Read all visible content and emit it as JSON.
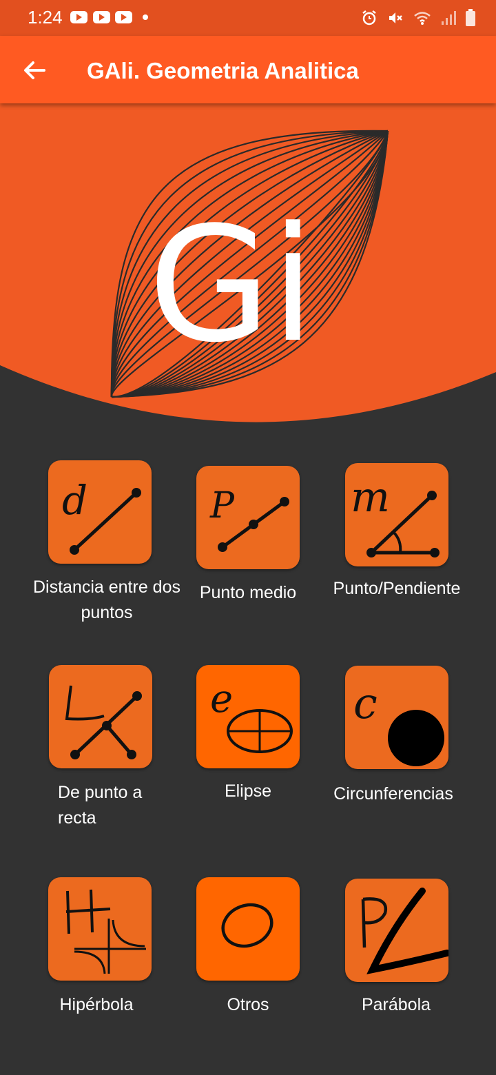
{
  "status_bar": {
    "time": "1:24",
    "icons": [
      "youtube-icon",
      "youtube-icon",
      "youtube-icon",
      "notification-dot",
      "alarm-icon",
      "mute-icon",
      "wifi-icon",
      "signal-icon",
      "battery-icon"
    ]
  },
  "app_bar": {
    "back_icon": "arrow-left-icon",
    "title": "GAli. Geometria Analitica"
  },
  "logo": {
    "text": "Gi"
  },
  "colors": {
    "status_bar": "#E2501F",
    "app_bar": "#FF5A22",
    "hero": "#F05A24",
    "background": "#323232",
    "tile": "#EC6A1F",
    "tile_bright": "#FF6600"
  },
  "menu": {
    "items": [
      {
        "label": "Distancia entre dos puntos",
        "icon": "distance-icon"
      },
      {
        "label": "Punto medio",
        "icon": "midpoint-icon"
      },
      {
        "label": "Punto/Pendiente",
        "icon": "slope-icon"
      },
      {
        "label": "De punto a recta",
        "icon": "point-line-icon"
      },
      {
        "label": "Elipse",
        "icon": "ellipse-icon"
      },
      {
        "label": "Circunferencias",
        "icon": "circle-icon"
      },
      {
        "label": "Hipérbola",
        "icon": "hyperbola-icon"
      },
      {
        "label": "Otros",
        "icon": "other-icon"
      },
      {
        "label": "Parábola",
        "icon": "parabola-icon"
      }
    ],
    "tile_letters": {
      "distance": "d",
      "midpoint": "P",
      "slope": "m",
      "point_line": "L",
      "ellipse": "e",
      "circle": "c",
      "hyperbola": "H",
      "other": "O",
      "parabola": "P"
    }
  }
}
